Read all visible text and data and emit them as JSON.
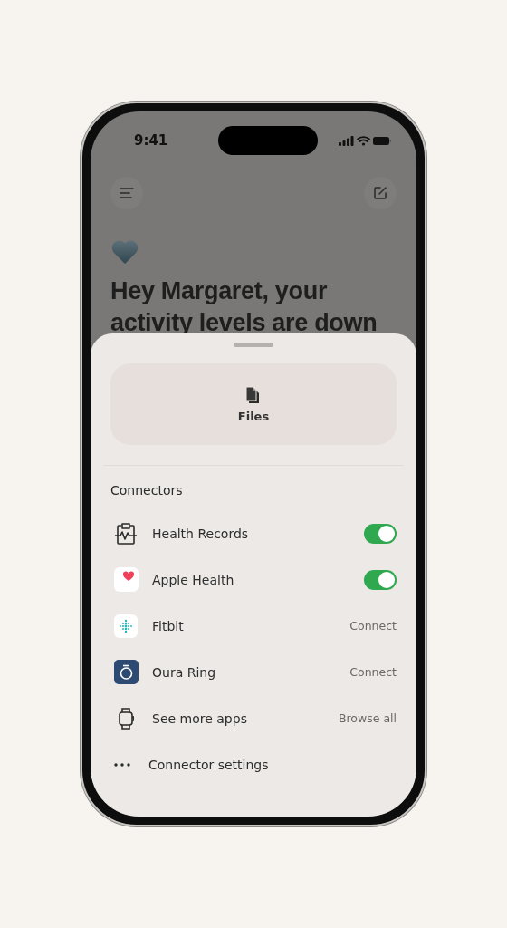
{
  "status_bar": {
    "time": "9:41"
  },
  "greeting": {
    "title_lines": [
      "Hey Margaret, your",
      "activity levels are down"
    ]
  },
  "sheet": {
    "files": {
      "label": "Files"
    },
    "connectors_title": "Connectors",
    "connectors": [
      {
        "kind": "toggle",
        "name": "Health Records",
        "on": true
      },
      {
        "kind": "toggle",
        "name": "Apple Health",
        "on": true
      },
      {
        "kind": "link",
        "name": "Fitbit",
        "action": "Connect"
      },
      {
        "kind": "link",
        "name": "Oura Ring",
        "action": "Connect"
      },
      {
        "kind": "link",
        "name": "See more apps",
        "action": "Browse all"
      },
      {
        "kind": "plain",
        "name": "Connector settings"
      }
    ]
  }
}
